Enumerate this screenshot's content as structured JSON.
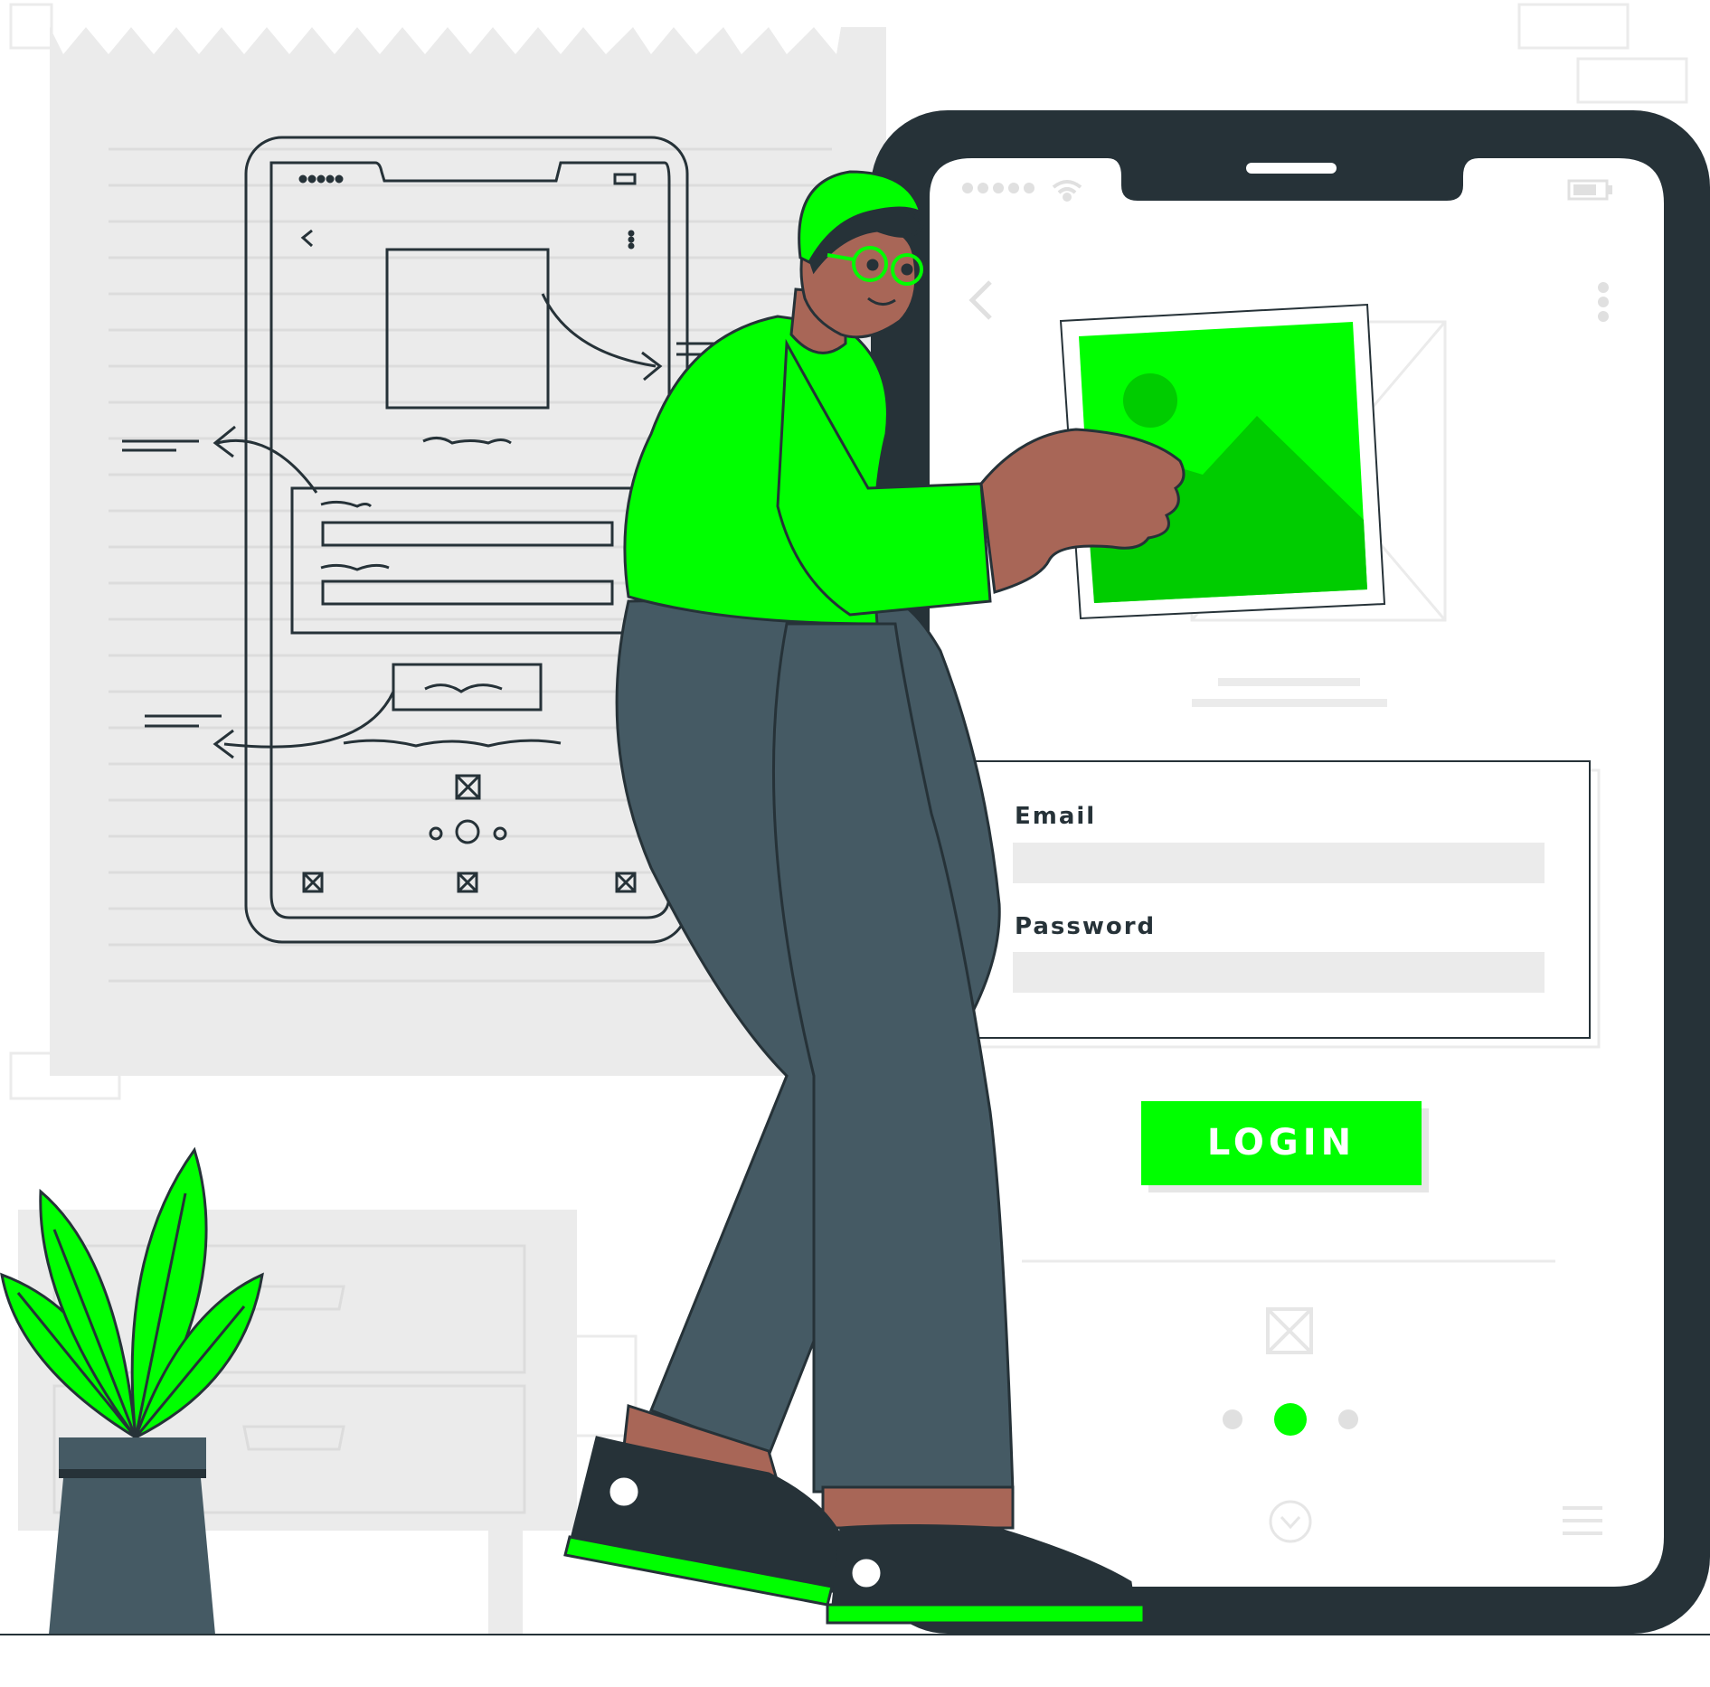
{
  "login_form": {
    "email_label": "Email",
    "email_value": "",
    "password_label": "Password",
    "password_value": "",
    "login_label": "LOGIN"
  },
  "carousel": {
    "page_count": 3,
    "active_page": 2
  },
  "colors": {
    "accent": "#00ff00",
    "accent_dark": "#00cc00",
    "phone_frame": "#263238",
    "pants": "#455a64",
    "skin": "#a86657",
    "sketch_paper": "#ebebeb",
    "field_bg": "#ebebeb"
  },
  "icons": [
    "signal-dots-icon",
    "wifi-icon",
    "battery-icon",
    "back-arrow-icon",
    "more-vertical-icon",
    "image-placeholder-icon",
    "broken-image-icon",
    "chevron-down-circle-icon",
    "menu-icon"
  ]
}
